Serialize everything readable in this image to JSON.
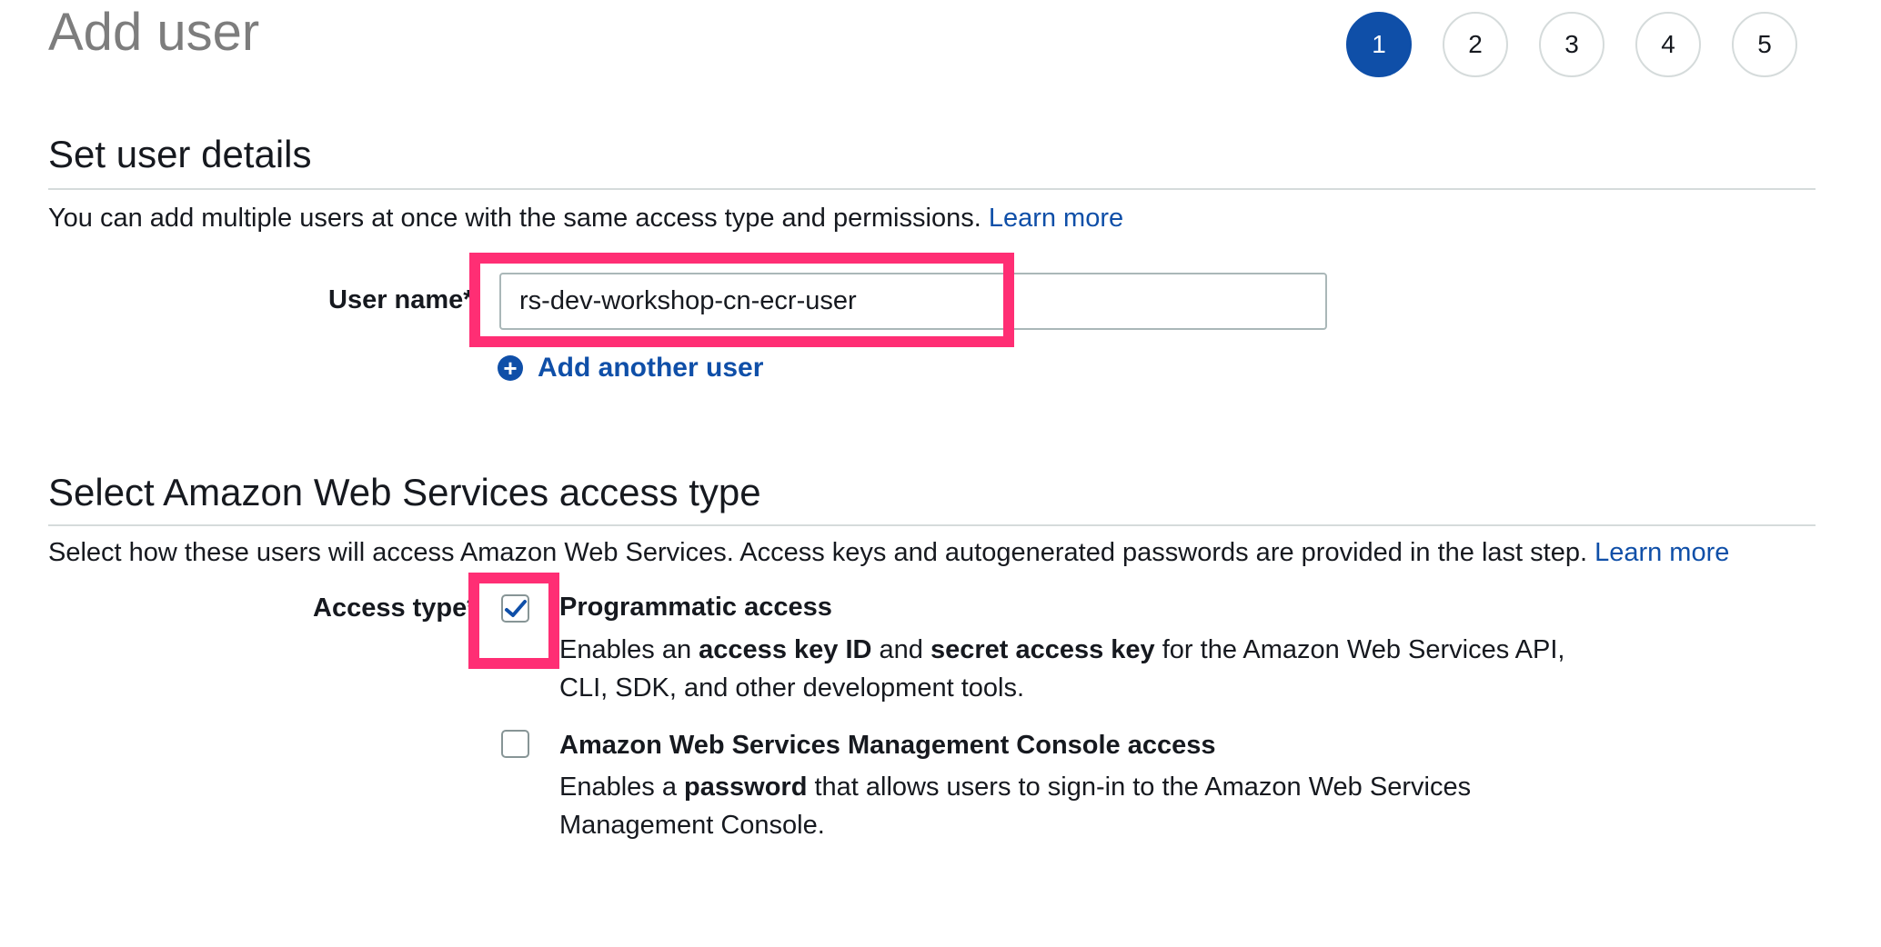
{
  "page": {
    "title": "Add user"
  },
  "steps": [
    {
      "label": "1",
      "active": true
    },
    {
      "label": "2",
      "active": false
    },
    {
      "label": "3",
      "active": false
    },
    {
      "label": "4",
      "active": false
    },
    {
      "label": "5",
      "active": false
    }
  ],
  "user_details": {
    "title": "Set user details",
    "description": "You can add multiple users at once with the same access type and permissions.",
    "learn_more": "Learn more",
    "user_name_label": "User name*",
    "user_name_value": "rs-dev-workshop-cn-ecr-user",
    "add_another_user": "Add another user"
  },
  "access_type": {
    "title": "Select Amazon Web Services access type",
    "description": "Select how these users will access Amazon Web Services. Access keys and autogenerated passwords are provided in the last step.",
    "learn_more": "Learn more",
    "label": "Access type*",
    "options": [
      {
        "title": "Programmatic access",
        "checked": true,
        "desc_line1_parts": [
          "Enables an ",
          "access key ID",
          " and ",
          "secret access key",
          " for the Amazon Web Services API,"
        ],
        "desc_line2": "CLI, SDK, and other development tools."
      },
      {
        "title": "Amazon Web Services Management Console access",
        "checked": false,
        "desc_line1_parts": [
          "Enables a ",
          "password",
          " that allows users to sign-in to the Amazon Web Services"
        ],
        "desc_line2": "Management Console."
      }
    ]
  },
  "colors": {
    "accent": "#0f4fa8",
    "highlight": "#ff2e74",
    "title_gray": "#7d7d7d"
  },
  "icons": {
    "add": "plus-circle-icon",
    "check": "checkmark-icon"
  }
}
